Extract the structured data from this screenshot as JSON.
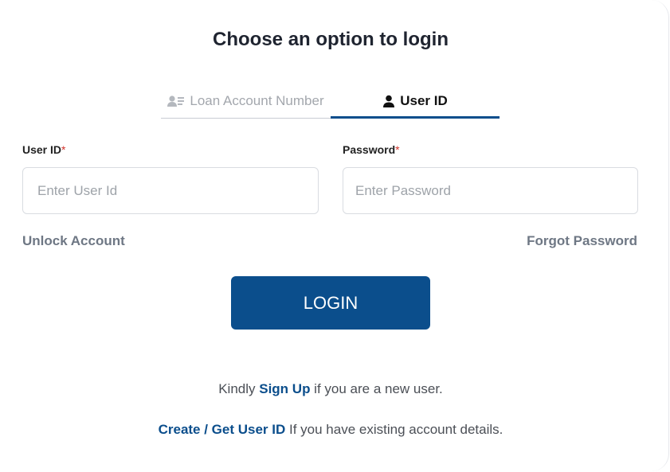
{
  "title": "Choose an option to login",
  "tabs": {
    "loan": {
      "label": "Loan Account Number",
      "icon": "user-card-icon"
    },
    "user": {
      "label": "User ID",
      "icon": "user-icon",
      "active": true
    }
  },
  "form": {
    "userid_label": "User ID",
    "userid_required": "*",
    "userid_placeholder": "Enter User Id",
    "password_label": "Password",
    "password_required": "*",
    "password_placeholder": "Enter Password"
  },
  "links": {
    "unlock": "Unlock Account",
    "forgot": "Forgot Password"
  },
  "login_label": "LOGIN",
  "footer": {
    "signup_pre": "Kindly ",
    "signup_link": "Sign Up",
    "signup_post": " if you are a new user.",
    "create_link": "Create / Get User ID",
    "create_post": " If you have existing account details."
  },
  "colors": {
    "primary": "#0b4e8c",
    "muted_link": "#6e7784",
    "required": "#d0342c"
  }
}
